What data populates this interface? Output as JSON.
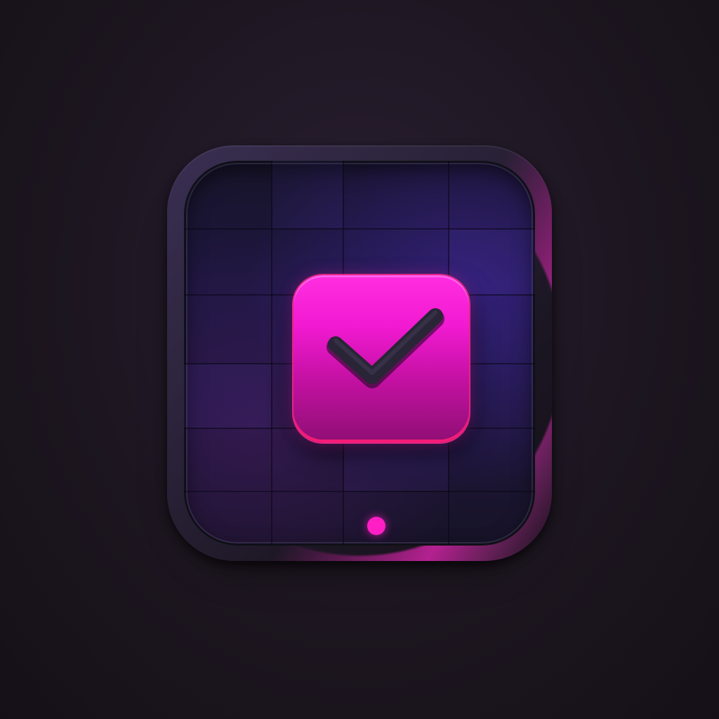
{
  "icon": {
    "name": "checklist-app-icon",
    "glyph": "checkmark",
    "accent_color": "#ff1fc4",
    "background_color": "#1d1620",
    "face_color": "#1c1740"
  },
  "status_indicator": {
    "color": "#ff1fc4"
  }
}
